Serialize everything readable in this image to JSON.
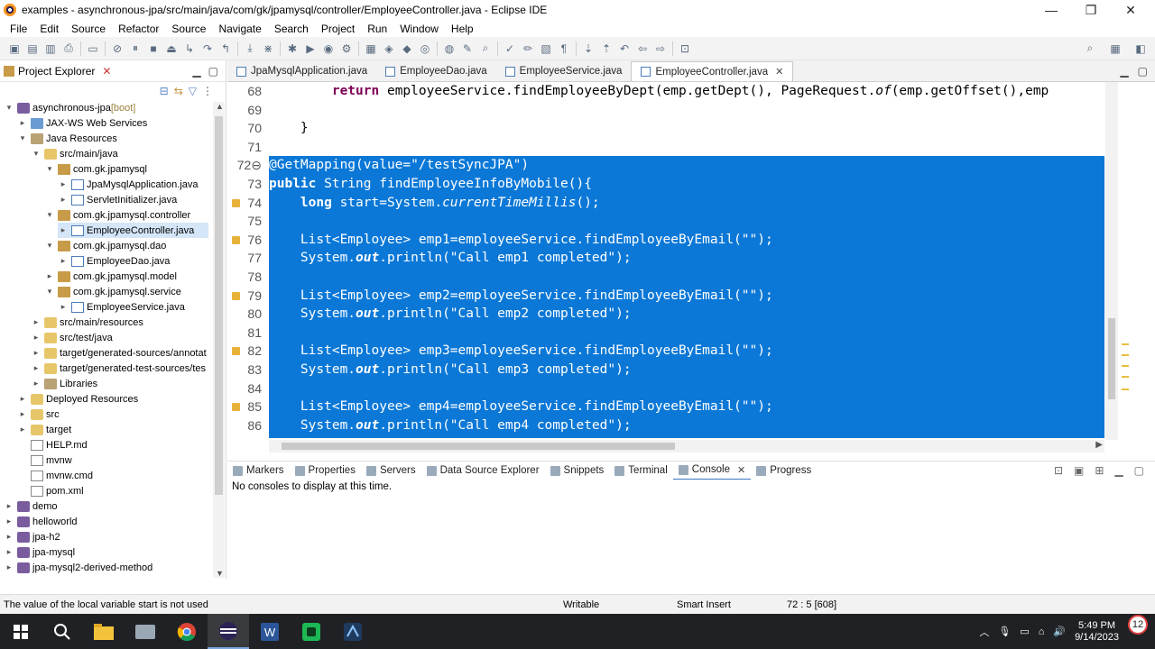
{
  "window": {
    "title": "examples - asynchronous-jpa/src/main/java/com/gk/jpamysql/controller/EmployeeController.java - Eclipse IDE"
  },
  "menu": [
    "File",
    "Edit",
    "Source",
    "Refactor",
    "Source",
    "Navigate",
    "Search",
    "Project",
    "Run",
    "Window",
    "Help"
  ],
  "project_explorer": {
    "title": "Project Explorer",
    "items": [
      {
        "label": "asynchronous-jpa",
        "suffix": " [boot]",
        "level": 0,
        "arrow": "▾",
        "icon": "project-icon"
      },
      {
        "label": "JAX-WS Web Services",
        "level": 1,
        "arrow": "▸",
        "icon": "webservice-icon"
      },
      {
        "label": "Java Resources",
        "level": 1,
        "arrow": "▾",
        "icon": "java-resources-icon"
      },
      {
        "label": "src/main/java",
        "level": 2,
        "arrow": "▾",
        "icon": "source-folder-icon"
      },
      {
        "label": "com.gk.jpamysql",
        "level": 3,
        "arrow": "▾",
        "icon": "package-icon"
      },
      {
        "label": "JpaMysqlApplication.java",
        "level": 4,
        "arrow": "▸",
        "icon": "java-file-icon"
      },
      {
        "label": "ServletInitializer.java",
        "level": 4,
        "arrow": "▸",
        "icon": "java-file-icon"
      },
      {
        "label": "com.gk.jpamysql.controller",
        "level": 3,
        "arrow": "▾",
        "icon": "package-icon"
      },
      {
        "label": "EmployeeController.java",
        "level": 4,
        "arrow": "▸",
        "icon": "java-file-icon",
        "selected": true
      },
      {
        "label": "com.gk.jpamysql.dao",
        "level": 3,
        "arrow": "▾",
        "icon": "package-icon"
      },
      {
        "label": "EmployeeDao.java",
        "level": 4,
        "arrow": "▸",
        "icon": "java-file-icon"
      },
      {
        "label": "com.gk.jpamysql.model",
        "level": 3,
        "arrow": "▸",
        "icon": "package-icon"
      },
      {
        "label": "com.gk.jpamysql.service",
        "level": 3,
        "arrow": "▾",
        "icon": "package-icon"
      },
      {
        "label": "EmployeeService.java",
        "level": 4,
        "arrow": "▸",
        "icon": "java-file-icon"
      },
      {
        "label": "src/main/resources",
        "level": 2,
        "arrow": "▸",
        "icon": "source-folder-icon"
      },
      {
        "label": "src/test/java",
        "level": 2,
        "arrow": "▸",
        "icon": "source-folder-icon"
      },
      {
        "label": "target/generated-sources/annotat",
        "level": 2,
        "arrow": "▸",
        "icon": "source-folder-icon"
      },
      {
        "label": "target/generated-test-sources/tes",
        "level": 2,
        "arrow": "▸",
        "icon": "source-folder-icon"
      },
      {
        "label": "Libraries",
        "level": 2,
        "arrow": "▸",
        "icon": "library-icon"
      },
      {
        "label": "Deployed Resources",
        "level": 1,
        "arrow": "▸",
        "icon": "folder-icon"
      },
      {
        "label": "src",
        "level": 1,
        "arrow": "▸",
        "icon": "folder-icon"
      },
      {
        "label": "target",
        "level": 1,
        "arrow": "▸",
        "icon": "folder-icon"
      },
      {
        "label": "HELP.md",
        "level": 1,
        "arrow": "",
        "icon": "file-icon"
      },
      {
        "label": "mvnw",
        "level": 1,
        "arrow": "",
        "icon": "file-icon"
      },
      {
        "label": "mvnw.cmd",
        "level": 1,
        "arrow": "",
        "icon": "file-icon"
      },
      {
        "label": "pom.xml",
        "level": 1,
        "arrow": "",
        "icon": "file-icon"
      },
      {
        "label": "demo",
        "level": 0,
        "arrow": "▸",
        "icon": "project-icon"
      },
      {
        "label": "helloworld",
        "level": 0,
        "arrow": "▸",
        "icon": "project-icon"
      },
      {
        "label": "jpa-h2",
        "level": 0,
        "arrow": "▸",
        "icon": "project-icon"
      },
      {
        "label": "jpa-mysql",
        "level": 0,
        "arrow": "▸",
        "icon": "project-icon"
      },
      {
        "label": "jpa-mysql2-derived-method",
        "level": 0,
        "arrow": "▸",
        "icon": "project-icon"
      }
    ]
  },
  "editor": {
    "tabs": [
      {
        "label": "JpaMysqlApplication.java",
        "active": false
      },
      {
        "label": "EmployeeDao.java",
        "active": false
      },
      {
        "label": "EmployeeService.java",
        "active": false
      },
      {
        "label": "EmployeeController.java",
        "active": true
      }
    ],
    "lines": [
      {
        "n": "68",
        "text": "        return employeeService.findEmployeeByDept(emp.getDept(), PageRequest.of(emp.getOffset(),emp",
        "sel": false
      },
      {
        "n": "69",
        "text": "",
        "sel": false
      },
      {
        "n": "70",
        "text": "    }",
        "sel": false
      },
      {
        "n": "71",
        "text": "",
        "sel": false
      },
      {
        "n": "72⊖",
        "text": "@GetMapping(value=\"/testSyncJPA\")",
        "sel": true
      },
      {
        "n": "73",
        "text": "public String findEmployeeInfoByMobile(){",
        "sel": true
      },
      {
        "n": "74",
        "text": "    long start=System.currentTimeMillis();",
        "sel": true,
        "warn": true
      },
      {
        "n": "75",
        "text": "",
        "sel": true
      },
      {
        "n": "76",
        "text": "    List<Employee> emp1=employeeService.findEmployeeByEmail(\"\");",
        "sel": true,
        "warn": true
      },
      {
        "n": "77",
        "text": "    System.out.println(\"Call emp1 completed\");",
        "sel": true
      },
      {
        "n": "78",
        "text": "",
        "sel": true
      },
      {
        "n": "79",
        "text": "    List<Employee> emp2=employeeService.findEmployeeByEmail(\"\");",
        "sel": true,
        "warn": true
      },
      {
        "n": "80",
        "text": "    System.out.println(\"Call emp2 completed\");",
        "sel": true
      },
      {
        "n": "81",
        "text": "",
        "sel": true
      },
      {
        "n": "82",
        "text": "    List<Employee> emp3=employeeService.findEmployeeByEmail(\"\");",
        "sel": true,
        "warn": true
      },
      {
        "n": "83",
        "text": "    System.out.println(\"Call emp3 completed\");",
        "sel": true
      },
      {
        "n": "84",
        "text": "",
        "sel": true
      },
      {
        "n": "85",
        "text": "    List<Employee> emp4=employeeService.findEmployeeByEmail(\"\");",
        "sel": true,
        "warn": true
      },
      {
        "n": "86",
        "text": "    System.out.println(\"Call emp4 completed\");",
        "sel": true
      }
    ]
  },
  "bottom_panel": {
    "tabs": [
      {
        "label": "Markers",
        "active": false
      },
      {
        "label": "Properties",
        "active": false
      },
      {
        "label": "Servers",
        "active": false
      },
      {
        "label": "Data Source Explorer",
        "active": false
      },
      {
        "label": "Snippets",
        "active": false
      },
      {
        "label": "Terminal",
        "active": false
      },
      {
        "label": "Console",
        "active": true
      },
      {
        "label": "Progress",
        "active": false
      }
    ],
    "message": "No consoles to display at this time."
  },
  "status": {
    "message": "The value of the local variable start is not used",
    "mode": "Writable",
    "insert": "Smart Insert",
    "position": "72 : 5 [608]"
  },
  "taskbar": {
    "time": "5:49 PM",
    "date": "9/14/2023",
    "notifications": "12"
  },
  "colors": {
    "selection": "#0b78d7",
    "keyword": "#7f0055",
    "taskbar": "#202124"
  }
}
